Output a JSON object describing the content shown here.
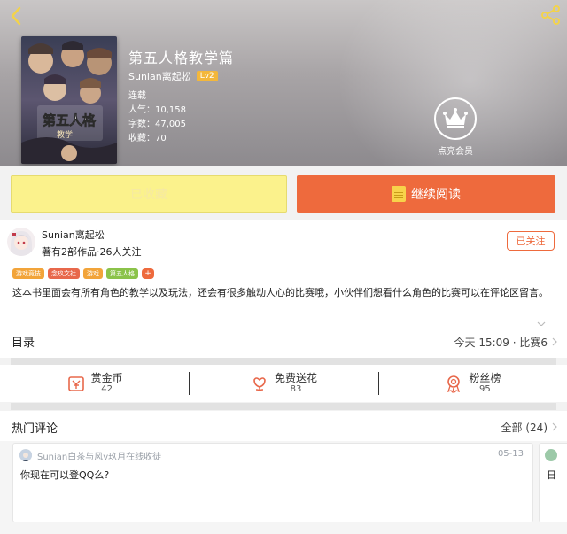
{
  "book": {
    "title": "第五人格教学篇",
    "author": "Sunian离起松",
    "level": "Lv2",
    "status": "连载",
    "popularity": "人气：10,158",
    "words": "字数：47,005",
    "favorites": "收藏：70",
    "cover_text": "第五人格教学"
  },
  "vip": {
    "label": "点亮会员"
  },
  "actions": {
    "collected_label": "已收藏",
    "read_label": "继续阅读"
  },
  "author": {
    "name": "Sunian离起松",
    "works": "著有2部作品·26人关注",
    "follow_label": "已关注"
  },
  "tags": [
    {
      "label": "游戏竞技",
      "color": "#f2a43a"
    },
    {
      "label": "念玖文社",
      "color": "#e8684b"
    },
    {
      "label": "游戏",
      "color": "#f2a43a"
    },
    {
      "label": "第五人格",
      "color": "#8bc34a"
    }
  ],
  "tag_more": "+",
  "description": "这本书里面会有所有角色的教学以及玩法，还会有很多触动人心的比赛哦，小伙伴们想看什么角色的比赛可以在评论区留言。",
  "toc": {
    "title": "目录",
    "latest": "今天 15:09 · 比赛6"
  },
  "stats": [
    {
      "label": "赏金币",
      "value": "42",
      "icon": "money-icon"
    },
    {
      "label": "免费送花",
      "value": "83",
      "icon": "flower-icon"
    },
    {
      "label": "粉丝榜",
      "value": "95",
      "icon": "medal-icon"
    }
  ],
  "comments": {
    "title": "热门评论",
    "all_label": "全部 (24)",
    "items": [
      {
        "user": "Sunian白茶与风v玖月在线收徒",
        "date": "05-13",
        "text": "你现在可以登QQ么?"
      },
      {
        "text": "日"
      }
    ]
  },
  "colors": {
    "accent": "#ee6a3d",
    "collected_bg": "#fbf28c"
  }
}
